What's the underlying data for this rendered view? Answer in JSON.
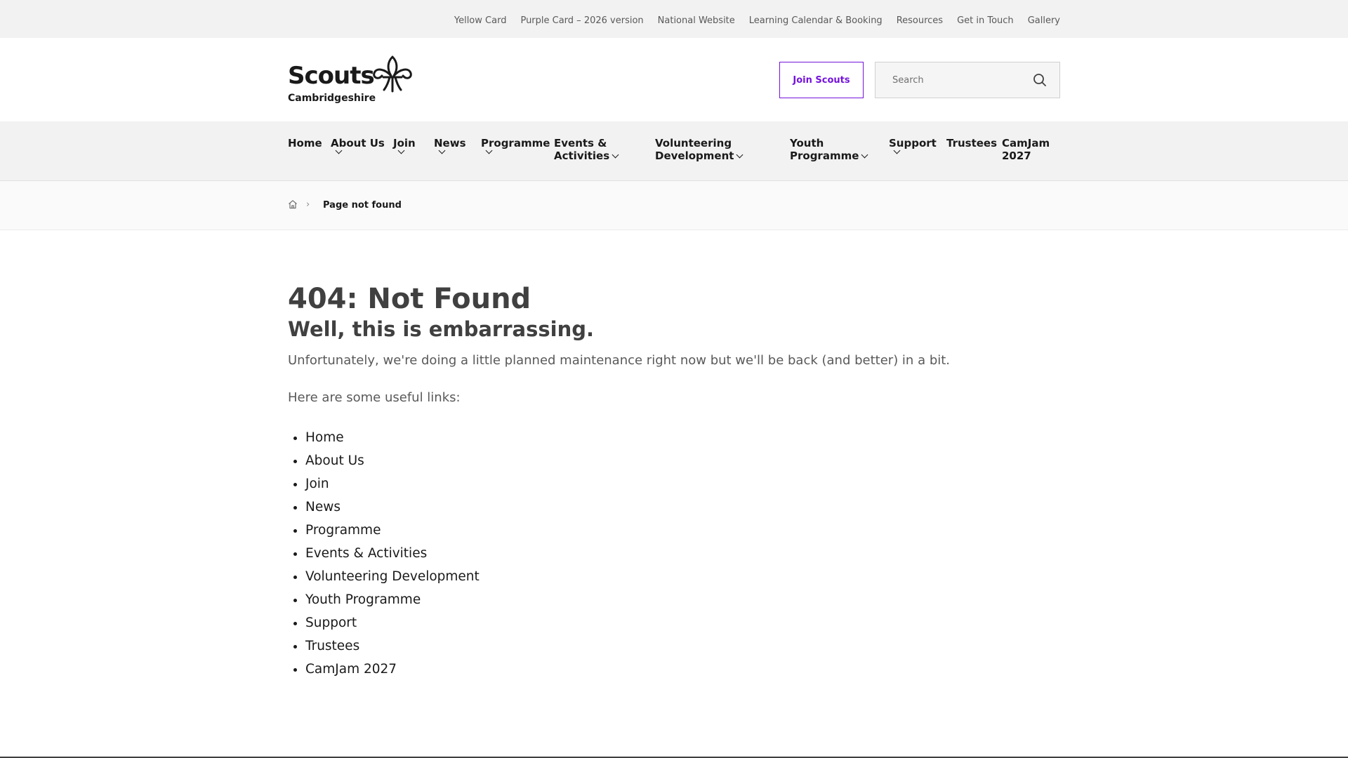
{
  "topbar": {
    "links": [
      "Yellow Card",
      "Purple Card – 2026 version",
      "National Website",
      "Learning Calendar & Booking",
      "Resources",
      "Get in Touch",
      "Gallery"
    ]
  },
  "header": {
    "logo_word": "Scouts",
    "logo_sub": "Cambridgeshire",
    "join_label": "Join Scouts",
    "search_placeholder": "Search"
  },
  "nav": {
    "home": "Home",
    "about_line1": "About Us",
    "join": "Join",
    "news": "News",
    "programme": "Programme",
    "events_line1": "Events &",
    "events_line2": "Activities",
    "volunteering_line1": "Volunteering",
    "volunteering_line2": "Development",
    "youth_line1": "Youth",
    "youth_line2": "Programme",
    "support": "Support",
    "trustees": "Trustees",
    "camjam_line1": "CamJam",
    "camjam_line2": "2027"
  },
  "breadcrumb": {
    "current": "Page not found"
  },
  "content": {
    "title": "404: Not Found",
    "subtitle": "Well, this is embarrassing.",
    "lead": "Unfortunately, we're doing a little planned maintenance right now but we'll be back (and better) in a bit.",
    "links_intro": "Here are some useful links:",
    "links": [
      "Home",
      "About Us",
      "Join",
      "News",
      "Programme",
      "Events & Activities",
      "Volunteering Development",
      "Youth Programme",
      "Support",
      "Trustees",
      "CamJam 2027"
    ]
  },
  "colors": {
    "accent": "#7413dc",
    "topbar_bg": "#f2f2f2",
    "nav_bg": "#f2f2f2",
    "text": "#404040"
  },
  "icons": {
    "logo": "fleur-de-lis-icon",
    "search": "search-icon",
    "breadcrumb_home": "home-icon",
    "dropdown": "chevron-down-icon"
  }
}
